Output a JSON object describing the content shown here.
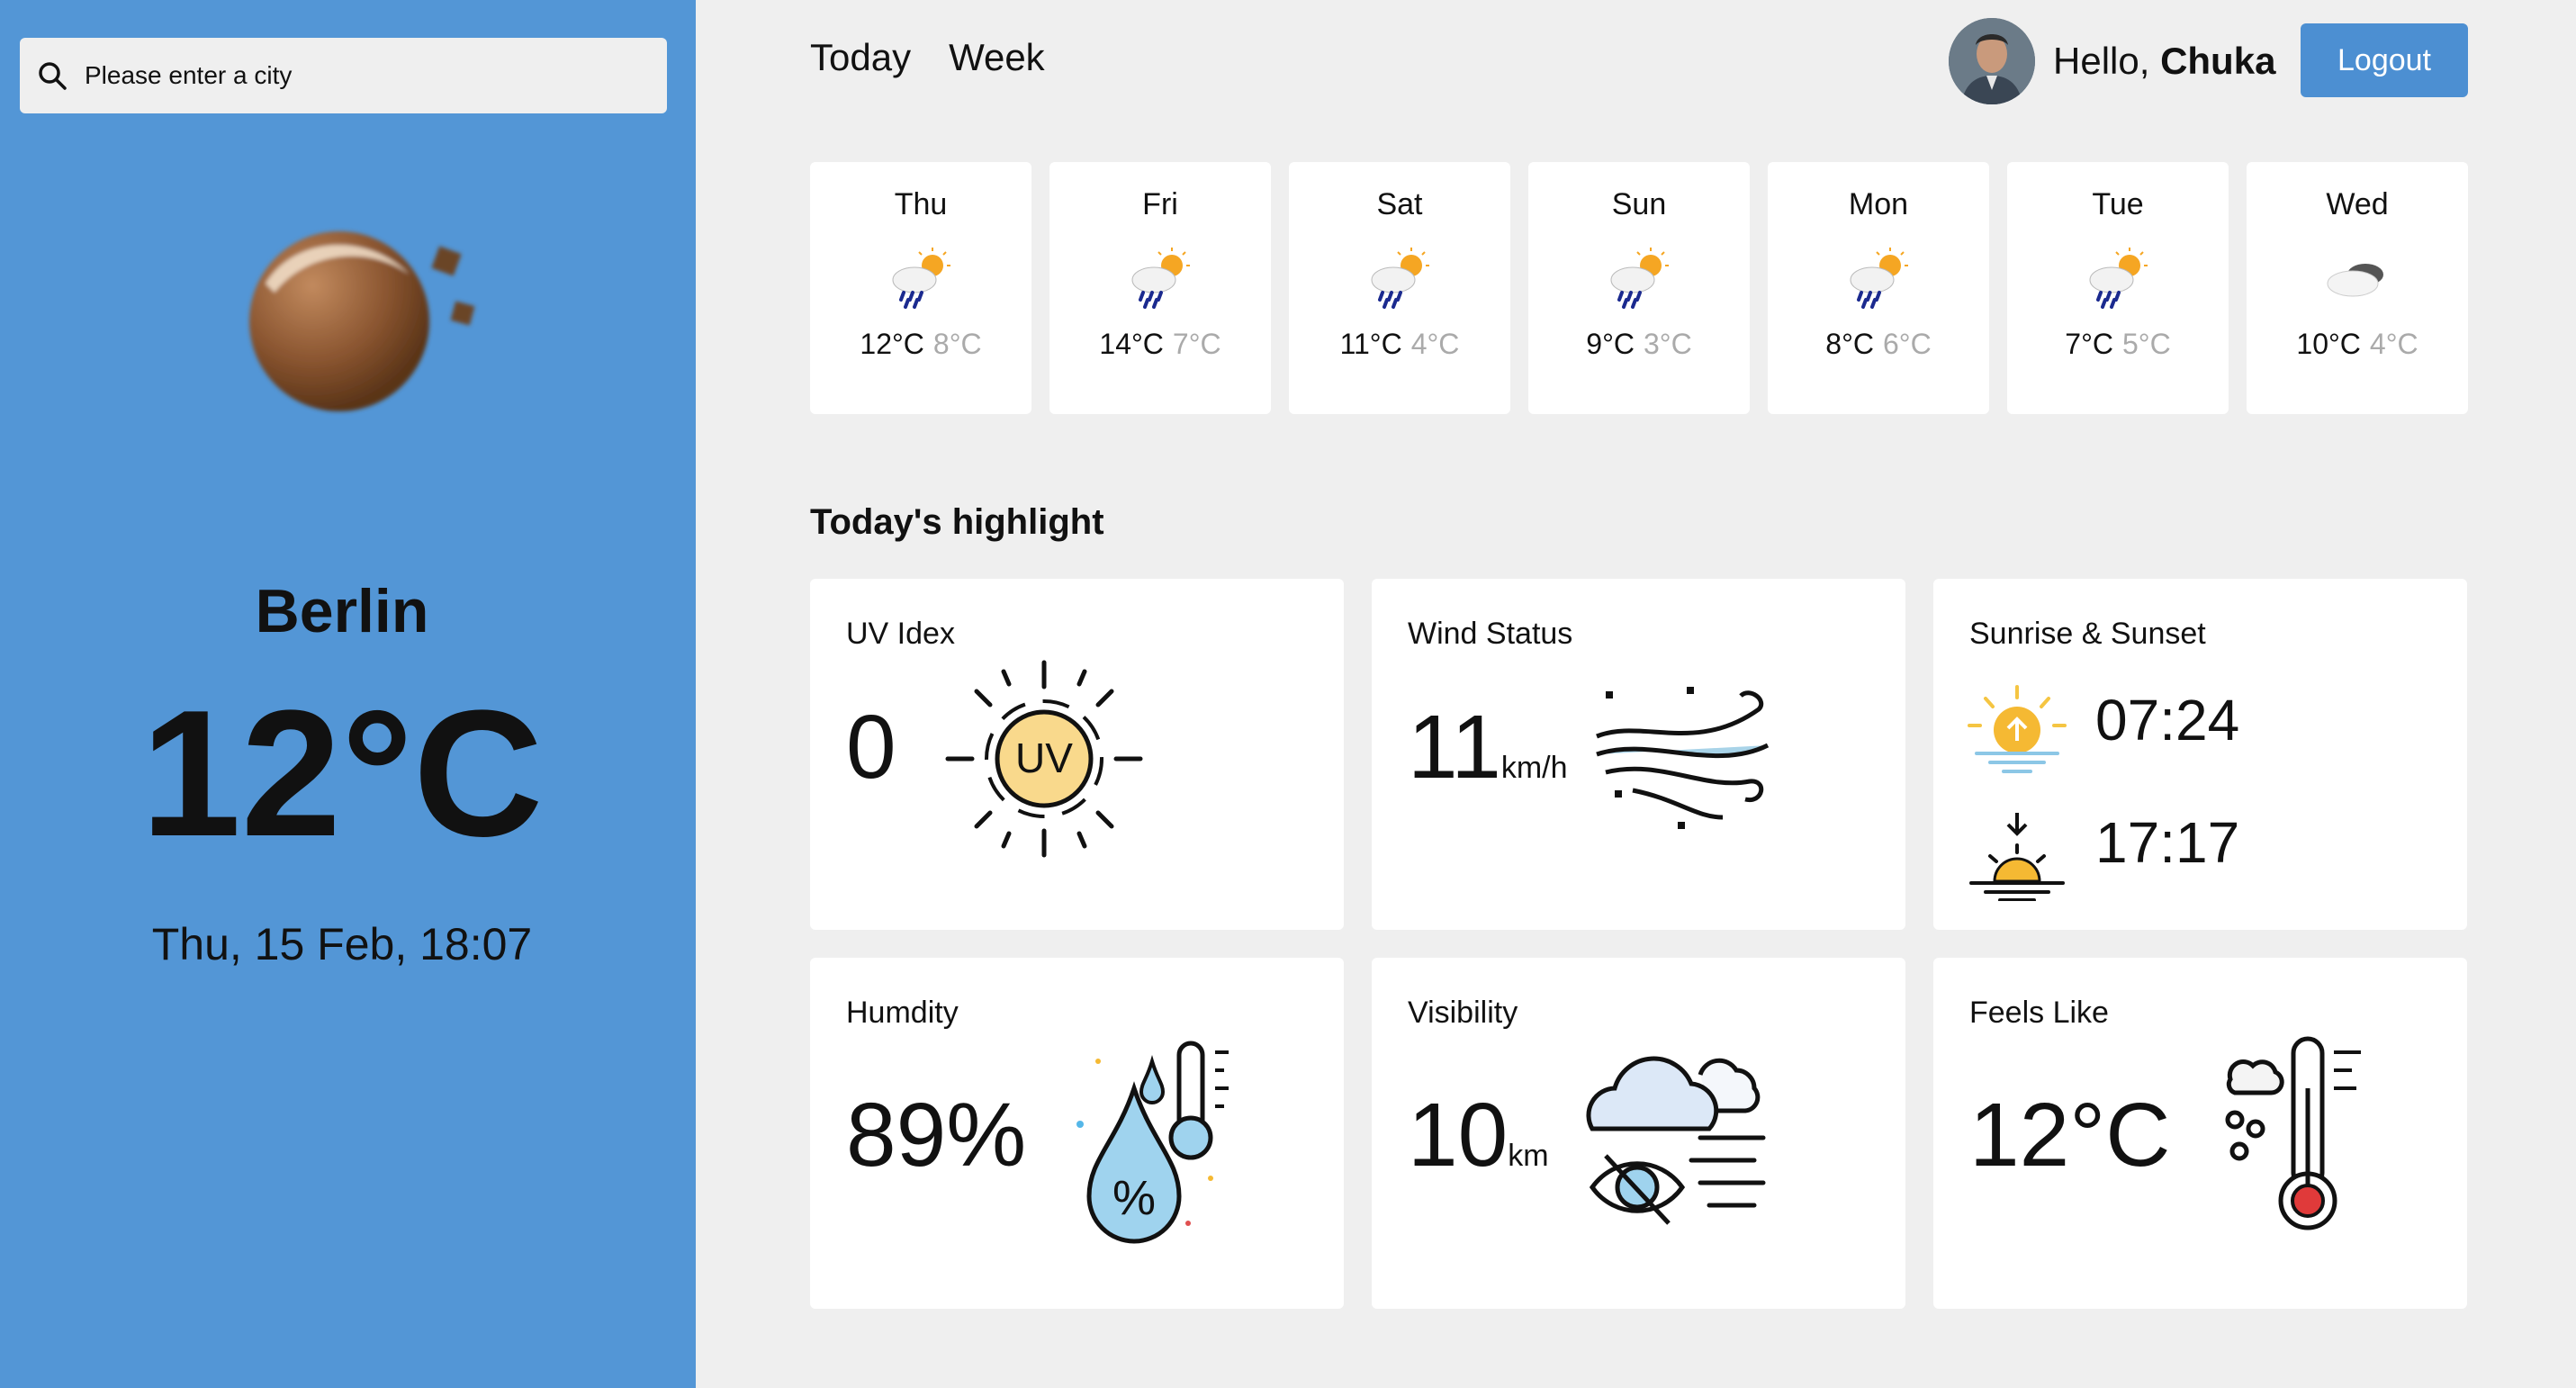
{
  "sidebar": {
    "search_placeholder": "Please enter a city",
    "search_icon": "search-icon",
    "current_icon": "night-moon-icon",
    "city": "Berlin",
    "temperature": "12°C",
    "datetime": "Thu, 15 Feb, 18:07",
    "background_color": "#5396d6"
  },
  "header": {
    "tabs": [
      {
        "label": "Today"
      },
      {
        "label": "Week"
      }
    ],
    "greeting": "Hello,",
    "user_name": "Chuka",
    "logout_label": "Logout"
  },
  "week": [
    {
      "day": "Thu",
      "high": "12°C",
      "low": "8°C",
      "icon": "rain-sun-icon"
    },
    {
      "day": "Fri",
      "high": "14°C",
      "low": "7°C",
      "icon": "rain-sun-icon"
    },
    {
      "day": "Sat",
      "high": "11°C",
      "low": "4°C",
      "icon": "rain-sun-icon"
    },
    {
      "day": "Sun",
      "high": "9°C",
      "low": "3°C",
      "icon": "rain-sun-icon"
    },
    {
      "day": "Mon",
      "high": "8°C",
      "low": "6°C",
      "icon": "rain-sun-icon"
    },
    {
      "day": "Tue",
      "high": "7°C",
      "low": "5°C",
      "icon": "rain-sun-icon"
    },
    {
      "day": "Wed",
      "high": "10°C",
      "low": "4°C",
      "icon": "cloud-icon"
    }
  ],
  "highlights": {
    "title": "Today's highlight",
    "uv": {
      "title": "UV Idex",
      "value": "0",
      "icon_text": "UV"
    },
    "wind": {
      "title": "Wind Status",
      "value": "11",
      "unit": "km/h"
    },
    "sun": {
      "title": "Sunrise & Sunset",
      "sunrise": "07:24",
      "sunset": "17:17"
    },
    "humidity": {
      "title": "Humdity",
      "value": "89%"
    },
    "visibility": {
      "title": "Visibility",
      "value": "10",
      "unit": "km"
    },
    "feels": {
      "title": "Feels Like",
      "value": "12°C"
    }
  }
}
